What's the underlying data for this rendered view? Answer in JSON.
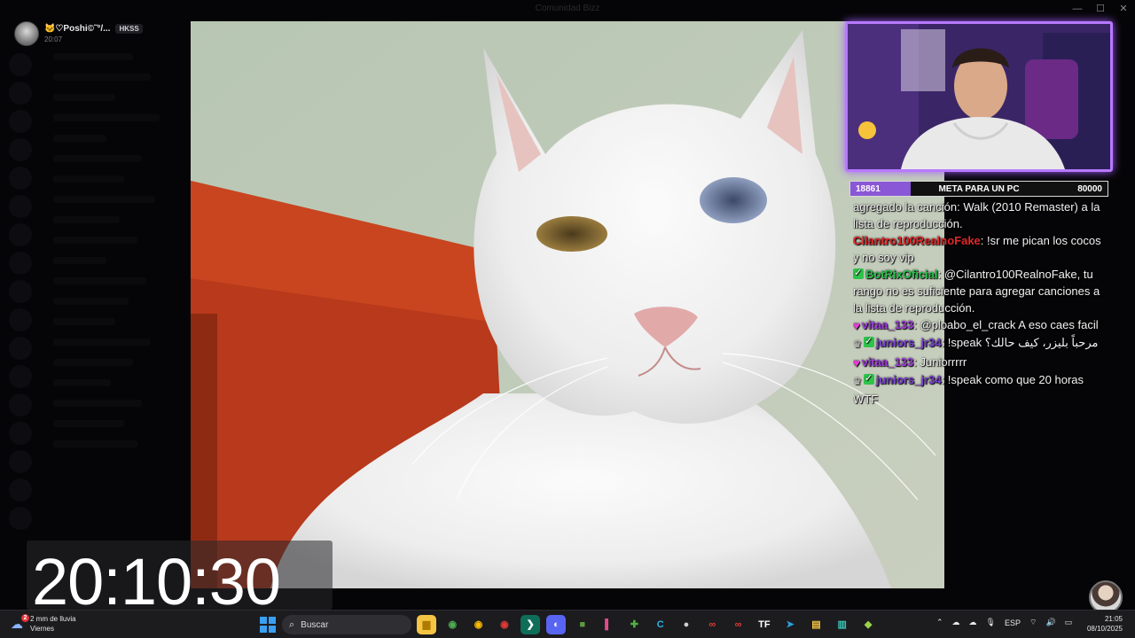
{
  "window": {
    "title": "Comunidad Bizz",
    "controls": [
      "—",
      "☐",
      "✕"
    ]
  },
  "discord_user": {
    "name": "🐱♡Poshi©˜°/...",
    "tag": "HKSS",
    "time": "20:07"
  },
  "goal": {
    "current": "18861",
    "title": "META PARA UN PC",
    "target": "80000",
    "progress_fraction": 0.236,
    "fill_color": "#8a57d6"
  },
  "chat": {
    "messages": [
      {
        "badges": [],
        "user": "",
        "user_color": "#ffffff",
        "text": "agregado la canción: Walk (2010 Remaster) a la lista de reproducción."
      },
      {
        "badges": [],
        "user": "Cilantro100RealnoFake",
        "user_color": "#e0282a",
        "text": ": !sr me pican los cocos y no soy vip"
      },
      {
        "badges": [
          "check"
        ],
        "user": "BotRixOficial",
        "user_color": "#27c04a",
        "text": ": @Cilantro100RealnoFake, tu rango no es suficiente para agregar canciones a la lista de reproducción."
      },
      {
        "badges": [
          "heart"
        ],
        "user": "vitaa_133",
        "user_color": "#a23de0",
        "text": ": @ploabo_el_crack A eso caes facil"
      },
      {
        "badges": [
          "crown",
          "check"
        ],
        "user": "juniors_jr34",
        "user_color": "#7b3fd6",
        "text": ": !speak مرحباً بليزر، كيف حالك؟"
      },
      {
        "badges": [
          "heart"
        ],
        "user": "vitaa_133",
        "user_color": "#a23de0",
        "text": ": Juniorrrrr"
      },
      {
        "badges": [
          "crown",
          "check"
        ],
        "user": "juniors_jr34",
        "user_color": "#7b3fd6",
        "text": ": !speak como que 20 horas WTF"
      }
    ]
  },
  "clock": "20:10:30",
  "taskbar": {
    "weather_line1": "2 mm de lluvia",
    "weather_line2": "Viernes",
    "weather_badge": "2",
    "search_placeholder": "Buscar",
    "apps": [
      {
        "name": "file-explorer-icon",
        "glyph": "▆",
        "bg": "#f4c542",
        "fg": "#b07a00"
      },
      {
        "name": "chrome-icon",
        "glyph": "◉",
        "bg": "#1c1c1f",
        "fg": "#4caf50"
      },
      {
        "name": "chrome-dev-icon",
        "glyph": "◉",
        "bg": "#1c1c1f",
        "fg": "#fbbc05"
      },
      {
        "name": "chrome-canary-icon",
        "glyph": "◉",
        "bg": "#1c1c1f",
        "fg": "#e53935"
      },
      {
        "name": "terminal-icon",
        "glyph": "❯",
        "bg": "#0f6e5a",
        "fg": "#ffffff"
      },
      {
        "name": "discord-icon",
        "glyph": "◐",
        "bg": "#5865f2",
        "fg": "#ffffff"
      },
      {
        "name": "minecraft-icon",
        "glyph": "■",
        "bg": "#1c1c1f",
        "fg": "#5e9c3c"
      },
      {
        "name": "obs-tool-icon",
        "glyph": "▌",
        "bg": "#1c1c1f",
        "fg": "#e24b8c"
      },
      {
        "name": "xbox-game-icon",
        "glyph": "✚",
        "bg": "#1c1c1f",
        "fg": "#52b043"
      },
      {
        "name": "c-app-icon",
        "glyph": "C",
        "bg": "#1c1c1f",
        "fg": "#2ab3e8"
      },
      {
        "name": "obs-icon",
        "glyph": "●",
        "bg": "#1c1c1f",
        "fg": "#cfcfcf"
      },
      {
        "name": "app-red-icon",
        "glyph": "∞",
        "bg": "#1c1c1f",
        "fg": "#e53935"
      },
      {
        "name": "app-red2-icon",
        "glyph": "∞",
        "bg": "#1c1c1f",
        "fg": "#e53935"
      },
      {
        "name": "tf-icon",
        "glyph": "TF",
        "bg": "#1c1c1f",
        "fg": "#ffffff"
      },
      {
        "name": "telegram-icon",
        "glyph": "➤",
        "bg": "#1c1c1f",
        "fg": "#2aa3e0"
      },
      {
        "name": "notes-icon",
        "glyph": "▤",
        "bg": "#1c1c1f",
        "fg": "#f4c542"
      },
      {
        "name": "editor-icon",
        "glyph": "▥",
        "bg": "#1c1c1f",
        "fg": "#3ec1b5"
      },
      {
        "name": "cube-app-icon",
        "glyph": "◆",
        "bg": "#1c1c1f",
        "fg": "#9bd24a"
      }
    ],
    "tray_lang": "ESP",
    "time": "21:05",
    "date": "08/10/2025"
  }
}
